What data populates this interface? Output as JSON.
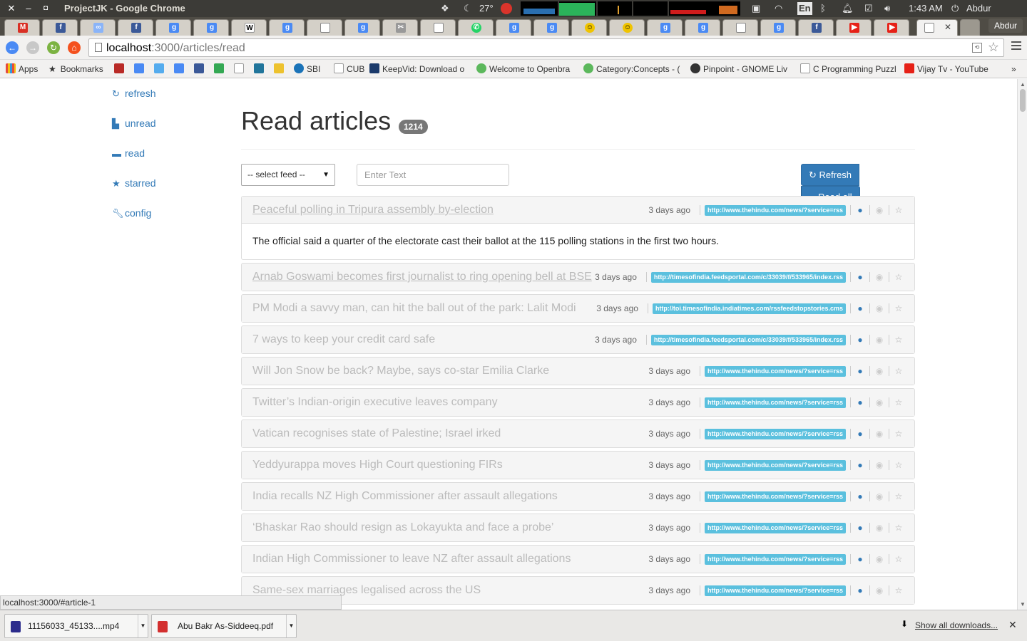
{
  "os": {
    "window_title": "ProjectJK - Google Chrome",
    "temperature": "27°",
    "keyboard_layout": "En",
    "clock": "1:43 AM",
    "user_name": "Abdur Rahman"
  },
  "browser": {
    "profile_name": "Abdur",
    "url_host": "localhost",
    "url_port_path": ":3000/articles/read",
    "bookmarks": [
      {
        "label": "Apps",
        "icon": "apps-grid-icon"
      },
      {
        "label": "Bookmarks",
        "icon": "star-icon"
      },
      {
        "label": "SBI",
        "icon": "sbi-icon"
      },
      {
        "label": "CUB",
        "icon": "page-icon"
      },
      {
        "label": "KeepVid: Download o",
        "icon": "keepvid-icon"
      },
      {
        "label": "Welcome to Openbra",
        "icon": "openbravo-icon"
      },
      {
        "label": "Category:Concepts - (",
        "icon": "openbravo-icon"
      },
      {
        "label": "Pinpoint - GNOME Liv",
        "icon": "gnome-icon"
      },
      {
        "label": "C Programming Puzzl",
        "icon": "page-icon"
      },
      {
        "label": "Vijay Tv - YouTube",
        "icon": "youtube-icon"
      }
    ],
    "status_url": "localhost:3000/#article-1"
  },
  "sidebar": {
    "items": [
      {
        "label": "refresh",
        "icon": "refresh-icon"
      },
      {
        "label": "unread",
        "icon": "file-icon"
      },
      {
        "label": "read",
        "icon": "folder-icon"
      },
      {
        "label": "starred",
        "icon": "star-icon"
      },
      {
        "label": "config",
        "icon": "wrench-icon"
      }
    ]
  },
  "main": {
    "title": "Read articles",
    "count": "1214",
    "feed_select_value": "-- select feed --",
    "search_placeholder": "Enter Text",
    "refresh_label": "Refresh",
    "read_all_label": "Read all"
  },
  "articles": [
    {
      "title": "Peaceful polling in Tripura assembly by-election",
      "time": "3 days ago",
      "feed": "http://www.thehindu.com/news/?service=rss",
      "body": "The official said a quarter of the electorate cast their ballot at the 115 polling stations in the first two hours."
    },
    {
      "title": "Arnab Goswami becomes first journalist to ring opening bell at BSE",
      "time": "3 days ago",
      "feed": "http://timesofindia.feedsportal.com/c/33039/f/533965/index.rss"
    },
    {
      "title": "PM Modi a savvy man, can hit the ball out of the park: Lalit Modi",
      "time": "3 days ago",
      "feed": "http://toi.timesofindia.indiatimes.com/rssfeedstopstories.cms"
    },
    {
      "title": "7 ways to keep your credit card safe",
      "time": "3 days ago",
      "feed": "http://timesofindia.feedsportal.com/c/33039/f/533965/index.rss"
    },
    {
      "title": "Will Jon Snow be back? Maybe, says co-star Emilia Clarke",
      "time": "3 days ago",
      "feed": "http://www.thehindu.com/news/?service=rss"
    },
    {
      "title": "Twitter’s Indian-origin executive leaves company",
      "time": "3 days ago",
      "feed": "http://www.thehindu.com/news/?service=rss"
    },
    {
      "title": "Vatican recognises state of Palestine; Israel irked",
      "time": "3 days ago",
      "feed": "http://www.thehindu.com/news/?service=rss"
    },
    {
      "title": "Yeddyurappa moves High Court questioning FIRs",
      "time": "3 days ago",
      "feed": "http://www.thehindu.com/news/?service=rss"
    },
    {
      "title": "India recalls NZ High Commissioner after assault allegations",
      "time": "3 days ago",
      "feed": "http://www.thehindu.com/news/?service=rss"
    },
    {
      "title": "‘Bhaskar Rao should resign as Lokayukta and face a probe’",
      "time": "3 days ago",
      "feed": "http://www.thehindu.com/news/?service=rss"
    },
    {
      "title": "Indian High Commissioner to leave NZ after assault allegations",
      "time": "3 days ago",
      "feed": "http://www.thehindu.com/news/?service=rss"
    },
    {
      "title": "Same-sex marriages legalised across the US",
      "time": "3 days ago",
      "feed": "http://www.thehindu.com/news/?service=rss"
    }
  ],
  "downloads": {
    "items": [
      {
        "name": "11156033_45133....mp4"
      },
      {
        "name": "Abu Bakr As-Siddeeq.pdf"
      }
    ],
    "show_all_label": "Show all downloads..."
  },
  "colors": {
    "link": "#337ab7",
    "primary_button": "#337ab7",
    "feed_label": "#5bc0de",
    "badge": "#777777",
    "globe_icon": "#337ab7"
  }
}
